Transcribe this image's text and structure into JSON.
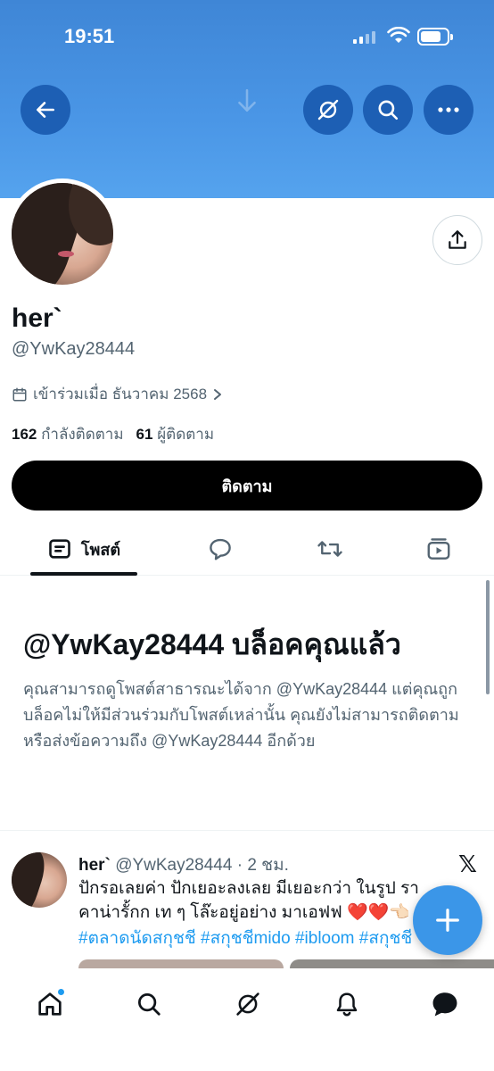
{
  "status_bar": {
    "time": "19:51"
  },
  "colors": {
    "banner": "#4a96e6",
    "accent": "#1d9bf0",
    "fab": "#3b96e8",
    "follow_button": "#000000"
  },
  "header_actions": {
    "back": "back-arrow-icon",
    "grok": "grok-icon",
    "search": "search-icon",
    "more": "more-icon",
    "share": "share-icon"
  },
  "profile": {
    "display_name": "her`",
    "handle": "@YwKay28444",
    "joined": "เข้าร่วมเมื่อ ธันวาคม 2568",
    "following_count": "162",
    "following_label": "กำลังติดตาม",
    "followers_count": "61",
    "followers_label": "ผู้ติดตาม",
    "follow_button": "ติดตาม"
  },
  "tabs": [
    {
      "label": "โพสต์",
      "icon": "posts-icon",
      "active": true
    },
    {
      "label": "",
      "icon": "replies-icon"
    },
    {
      "label": "",
      "icon": "reposts-icon"
    },
    {
      "label": "",
      "icon": "media-icon"
    }
  ],
  "blocked": {
    "title": "@YwKay28444 บล็อคคุณแล้ว",
    "body": "คุณสามารถดูโพสต์สาธารณะได้จาก @YwKay28444 แต่คุณถูกบล็อคไม่ให้มีส่วนร่วมกับโพสต์เหล่านั้น คุณยังไม่สามารถติดตามหรือส่งข้อความถึง @YwKay28444 อีกด้วย"
  },
  "post": {
    "name": "her`",
    "meta": "@YwKay28444 · 2 ชม.",
    "text": "ปักรอเลยค่า ปักเยอะลงเลย มีเยอะกว่า ในรูป ราคาน่ารั้กก เท ๆ โล๊ะอยู่อย่าง มาเอฟฟ",
    "emoji": "❤️❤️👈🏻",
    "tags": "#ตลาดนัดสกุชชี่ #สกุชชี่mido #ibloom #สกุชชี่"
  },
  "bottom_nav": [
    {
      "icon": "home-icon",
      "active": true,
      "notification_dot": true
    },
    {
      "icon": "search-icon"
    },
    {
      "icon": "grok-icon"
    },
    {
      "icon": "notifications-icon"
    },
    {
      "icon": "messages-icon"
    }
  ]
}
